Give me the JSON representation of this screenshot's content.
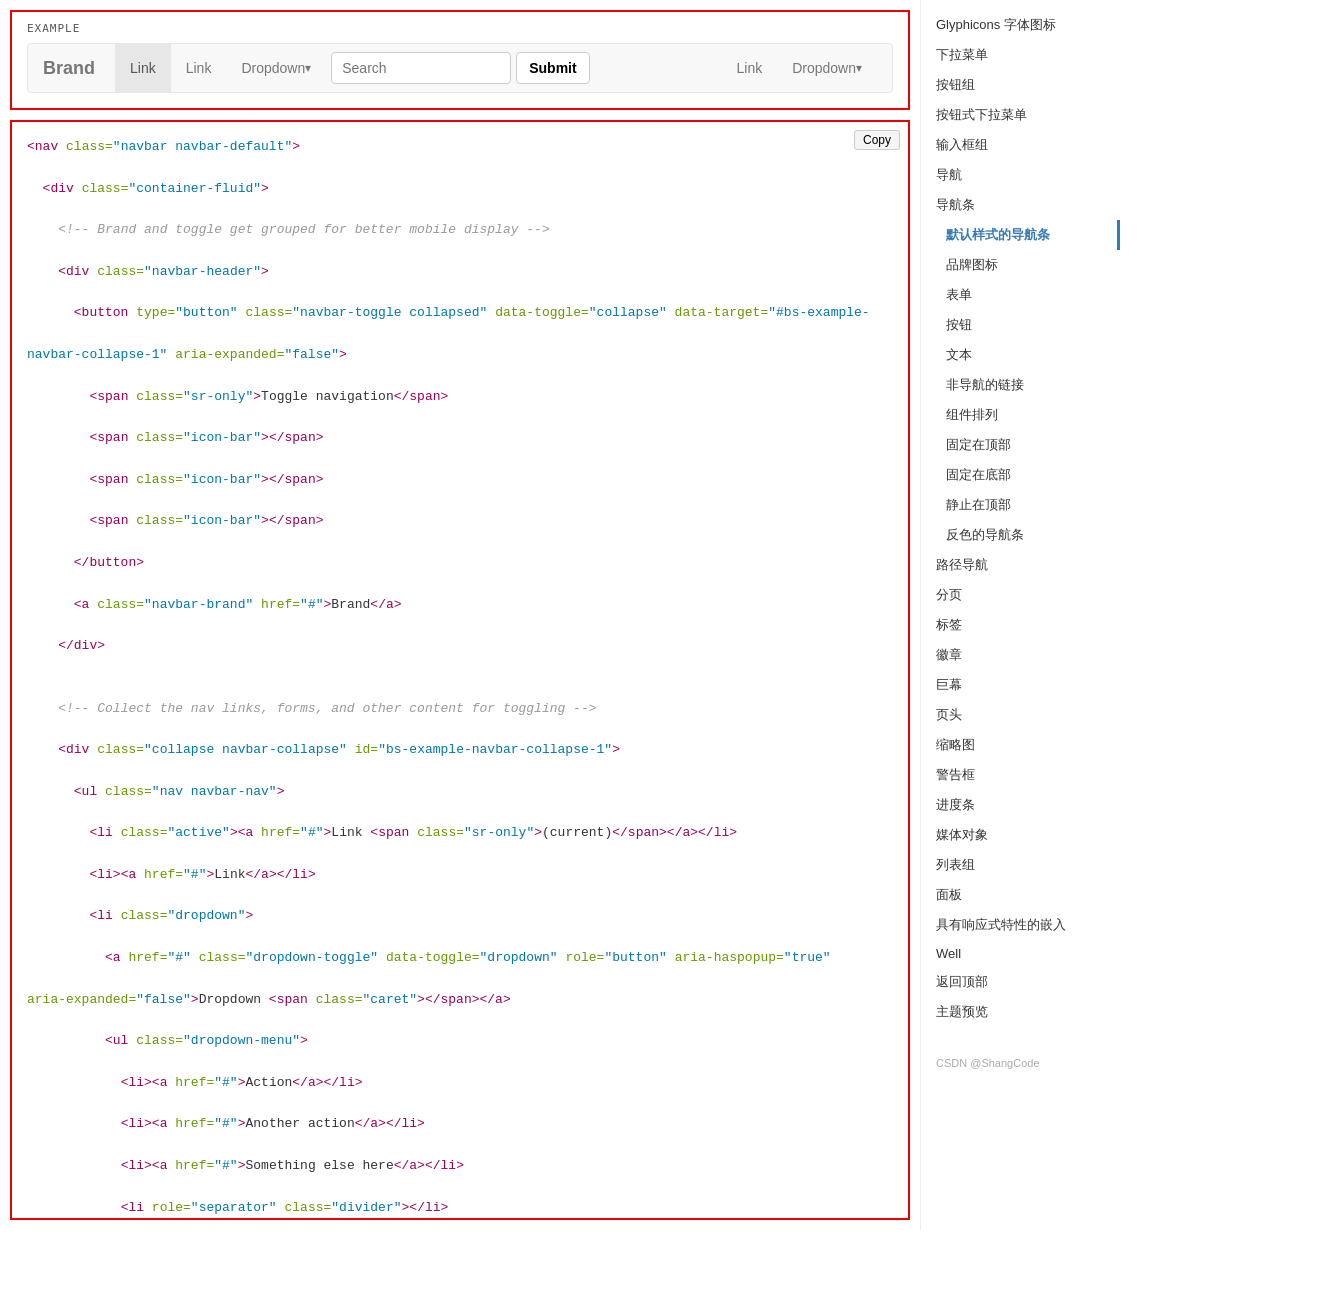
{
  "example": {
    "label": "EXAMPLE",
    "navbar": {
      "brand": "Brand",
      "nav_left": [
        {
          "label": "Link",
          "active": true
        },
        {
          "label": "Link",
          "active": false
        },
        {
          "label": "Dropdown",
          "dropdown": true
        }
      ],
      "search_placeholder": "Search",
      "submit_label": "Submit",
      "nav_right": [
        {
          "label": "Link",
          "active": false
        },
        {
          "label": "Dropdown",
          "dropdown": true
        }
      ]
    }
  },
  "copy_label": "Copy",
  "sidebar": {
    "items": [
      {
        "label": "Glyphicons 字体图标",
        "active": false
      },
      {
        "label": "下拉菜单",
        "active": false
      },
      {
        "label": "按钮组",
        "active": false
      },
      {
        "label": "按钮式下拉菜单",
        "active": false
      },
      {
        "label": "输入框组",
        "active": false
      },
      {
        "label": "导航",
        "active": false
      },
      {
        "label": "导航条",
        "active": true
      },
      {
        "label": "默认样式的导航条",
        "active": true,
        "sub": true
      },
      {
        "label": "品牌图标",
        "active": false,
        "sub": true
      },
      {
        "label": "表单",
        "active": false,
        "sub": true
      },
      {
        "label": "按钮",
        "active": false,
        "sub": true
      },
      {
        "label": "文本",
        "active": false,
        "sub": true
      },
      {
        "label": "非导航的链接",
        "active": false,
        "sub": true
      },
      {
        "label": "组件排列",
        "active": false,
        "sub": true
      },
      {
        "label": "固定在顶部",
        "active": false,
        "sub": true
      },
      {
        "label": "固定在底部",
        "active": false,
        "sub": true
      },
      {
        "label": "静止在顶部",
        "active": false,
        "sub": true
      },
      {
        "label": "反色的导航条",
        "active": false,
        "sub": true
      },
      {
        "label": "路径导航",
        "active": false
      },
      {
        "label": "分页",
        "active": false
      },
      {
        "label": "标签",
        "active": false
      },
      {
        "label": "徽章",
        "active": false
      },
      {
        "label": "巨幕",
        "active": false
      },
      {
        "label": "页头",
        "active": false
      },
      {
        "label": "缩略图",
        "active": false
      },
      {
        "label": "警告框",
        "active": false
      },
      {
        "label": "进度条",
        "active": false
      },
      {
        "label": "媒体对象",
        "active": false
      },
      {
        "label": "列表组",
        "active": false
      },
      {
        "label": "面板",
        "active": false
      },
      {
        "label": "具有响应式特性的嵌入",
        "active": false
      },
      {
        "label": "Well",
        "active": false
      },
      {
        "label": "返回顶部",
        "active": false
      },
      {
        "label": "主题预览",
        "active": false
      }
    ],
    "footer": "CSDN @ShangCode"
  }
}
